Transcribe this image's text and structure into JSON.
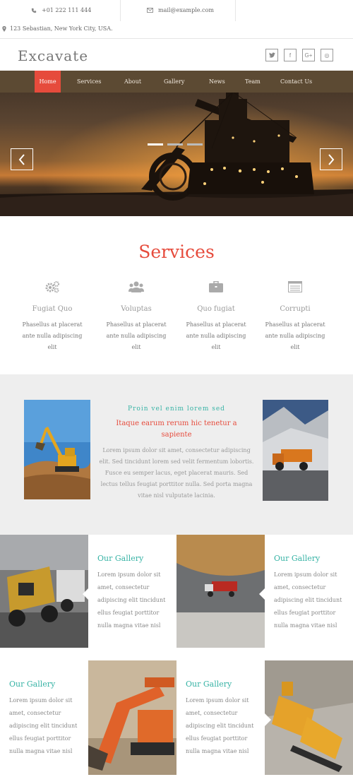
{
  "topbar": {
    "phone": "+01 222 111 444",
    "email": "mail@example.com",
    "address": "123 Sebastian, New York City, USA."
  },
  "header": {
    "logo": "Excavate",
    "socials": [
      {
        "icon": "twitter-icon",
        "glyph": "🐦"
      },
      {
        "icon": "facebook-icon",
        "glyph": "f"
      },
      {
        "icon": "google-plus-icon",
        "glyph": "G+"
      },
      {
        "icon": "dribbble-icon",
        "glyph": "◎"
      }
    ]
  },
  "nav": {
    "items": [
      "Home",
      "Services",
      "About",
      "Gallery",
      "News",
      "Team",
      "Contact Us"
    ],
    "active": "Home"
  },
  "services": {
    "title": "Services",
    "items": [
      {
        "icon": "gears-icon",
        "title": "Fugiat Quo",
        "text": "Phasellus at placerat ante nulla adipiscing elit"
      },
      {
        "icon": "users-icon",
        "title": "Voluptas",
        "text": "Phasellus at placerat ante nulla adipiscing elit"
      },
      {
        "icon": "briefcase-icon",
        "title": "Quo fugiat",
        "text": "Phasellus at placerat ante nulla adipiscing elit"
      },
      {
        "icon": "list-icon",
        "title": "Corrupti",
        "text": "Phasellus at placerat ante nulla adipiscing elit"
      }
    ]
  },
  "about": {
    "subtitle": "Proin vel enim lorem sed",
    "title": "Itaque earum rerum hic tenetur a sapiente",
    "text": "Lorem ipsum dolor sit amet, consectetur adipiscing elit. Sed tincidunt lorem sed velit fermentum lobortis. Fusce eu semper lacus, eget placerat mauris. Sed lectus tellus feugiat porttitor nulla. Sed porta magna vitae nisl vulputate lacinia."
  },
  "gallery": {
    "items": [
      {
        "title": "Our Gallery",
        "text": "Lorem ipsum dolor sit amet, consectetur adipiscing elit tincidunt ellus feugiat porttitor nulla magna vitae nisl"
      },
      {
        "title": "Our Gallery",
        "text": "Lorem ipsum dolor sit amet, consectetur adipiscing elit tincidunt ellus feugiat porttitor nulla magna vitae nisl"
      },
      {
        "title": "Our Gallery",
        "text": "Lorem ipsum dolor sit amet, consectetur adipiscing elit tincidunt ellus feugiat porttitor nulla magna vitae nisl"
      },
      {
        "title": "Our Gallery",
        "text": "Lorem ipsum dolor sit amet, consectetur adipiscing elit tincidunt ellus feugiat porttitor nulla magna vitae nisl"
      }
    ]
  },
  "colors": {
    "accent": "#e64b3c",
    "teal": "#37b3a5",
    "nav_bg": "#5c4a33"
  }
}
